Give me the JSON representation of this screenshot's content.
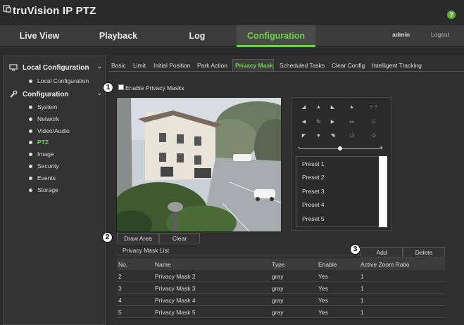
{
  "brand": {
    "name": "truVision  IP PTZ",
    "help": "?"
  },
  "nav": {
    "tabs": [
      "Live View",
      "Playback",
      "Log",
      "Configuration"
    ],
    "user": "admin",
    "logout": "Logout"
  },
  "sidebar": {
    "local_group": "Local Configuration",
    "local_items": [
      "Local Configuration"
    ],
    "config_group": "Configuration",
    "config_items": [
      "System",
      "Network",
      "Video/Audio",
      "PTZ",
      "Image",
      "Security",
      "Events",
      "Storage"
    ]
  },
  "subtabs": [
    "Basic",
    "Limit",
    "Initial Position",
    "Park Action",
    "Privacy Mask",
    "Scheduled Tasks",
    "Clear Config",
    "Intelligent Tracking"
  ],
  "callouts": [
    "1",
    "2",
    "3"
  ],
  "privacy": {
    "enable_label": "Enable Privacy Masks",
    "draw_area": "Draw Area",
    "clear": "Clear",
    "list_title": "Privacy Mask List",
    "add": "Add",
    "delete": "Delete"
  },
  "ptz": {
    "presets": [
      "Preset 1",
      "Preset 2",
      "Preset 3",
      "Preset 4",
      "Preset 5"
    ],
    "zoom_minus": "-",
    "zoom_plus": "+"
  },
  "table": {
    "headers": [
      "No.",
      "Name",
      "Type",
      "Enable",
      "Active Zoom Ratio"
    ],
    "rows": [
      [
        "2",
        "Privacy Mask 2",
        "gray",
        "Yes",
        "1"
      ],
      [
        "3",
        "Privacy Mask 3",
        "gray",
        "Yes",
        "1"
      ],
      [
        "4",
        "Privacy Mask 4",
        "gray",
        "Yes",
        "1"
      ],
      [
        "5",
        "Privacy Mask 5",
        "gray",
        "Yes",
        "1"
      ]
    ]
  },
  "colors": {
    "accent": "#6fd24a",
    "background": "#2b2b2b",
    "help": "#5fae3a"
  }
}
